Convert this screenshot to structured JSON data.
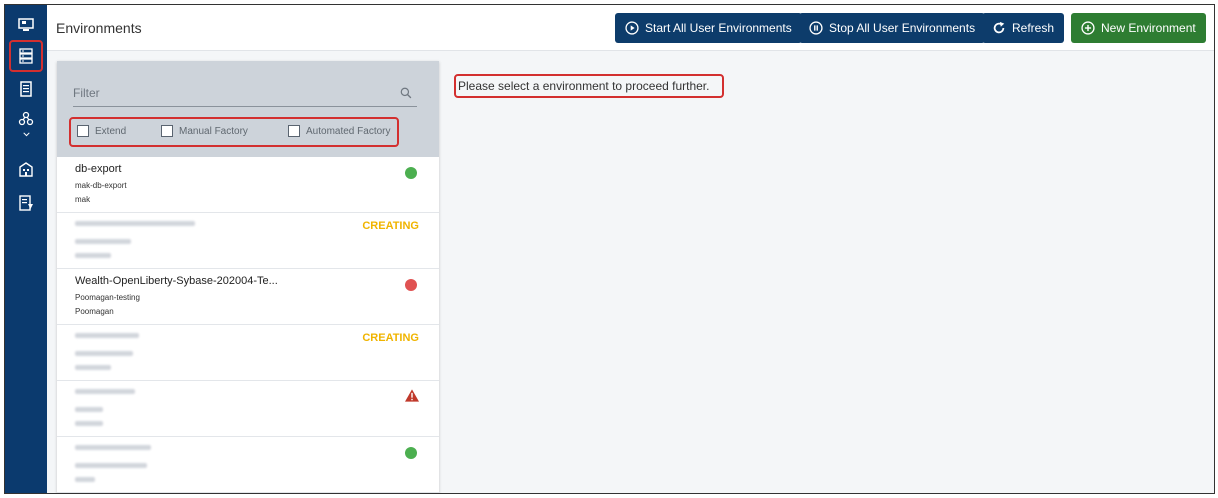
{
  "header": {
    "title": "Environments",
    "buttons": {
      "start_all": "Start All User Environments",
      "stop_all": "Stop All User Environments",
      "refresh": "Refresh",
      "new_env": "New Environment"
    }
  },
  "sidebar": {
    "items": [
      {
        "icon": "monitor-icon",
        "active": false
      },
      {
        "icon": "server-icon",
        "active": true
      },
      {
        "icon": "document-icon",
        "active": false
      },
      {
        "icon": "network-nodes-icon",
        "active": false
      },
      {
        "icon": "building-icon",
        "active": false
      },
      {
        "icon": "report-icon",
        "active": false
      }
    ]
  },
  "filter": {
    "placeholder": "Filter",
    "checkboxes": [
      "Extend",
      "Manual Factory",
      "Automated Factory"
    ]
  },
  "environments": [
    {
      "name": "db-export",
      "sub": "mak-db-export",
      "owner": "mak",
      "state": "running",
      "state_color": "#4caf50"
    },
    {
      "name": "",
      "sub": "",
      "owner": "",
      "state": "CREATING",
      "state_color": "#f0b400"
    },
    {
      "name": "Wealth-OpenLiberty-Sybase-202004-Te...",
      "sub": "Poomagan-testing",
      "owner": "Poomagan",
      "state": "stopped",
      "state_color": "#e05252"
    },
    {
      "name": "",
      "sub": "",
      "owner": "",
      "state": "CREATING",
      "state_color": "#f0b400"
    },
    {
      "name": "",
      "sub": "",
      "owner": "",
      "state": "error",
      "state_color": "#c0392b"
    },
    {
      "name": "",
      "sub": "",
      "owner": "",
      "state": "running",
      "state_color": "#4caf50"
    }
  ],
  "message": "Please select a environment to proceed further."
}
